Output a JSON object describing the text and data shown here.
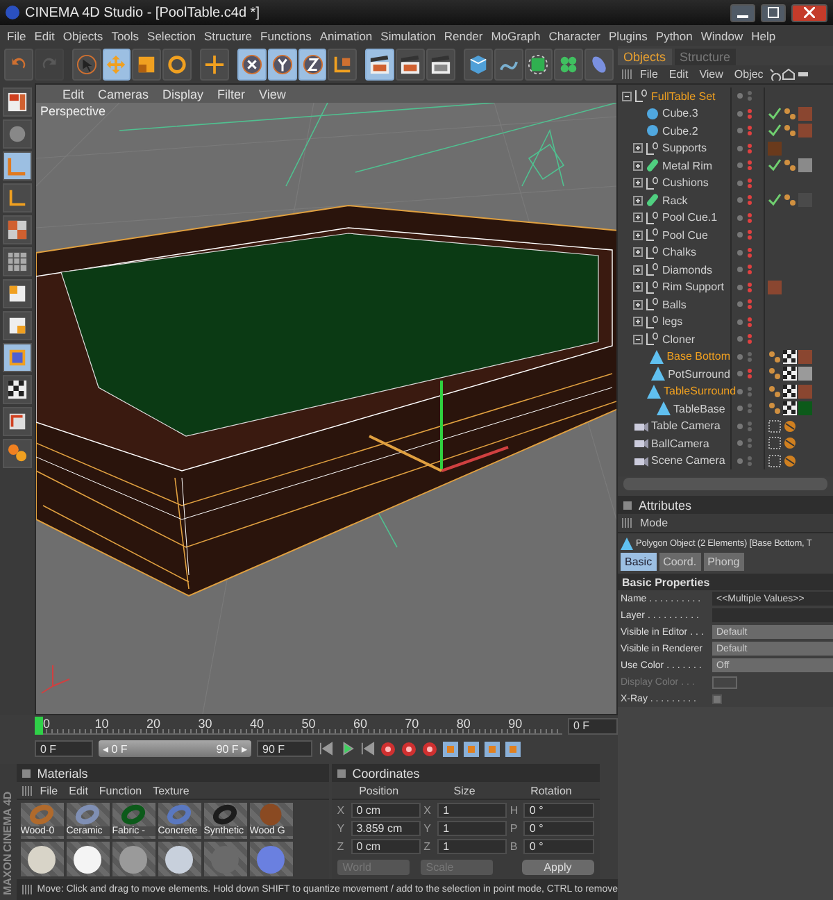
{
  "window": {
    "title": "CINEMA 4D Studio - [PoolTable.c4d *]"
  },
  "menu": [
    "File",
    "Edit",
    "Objects",
    "Tools",
    "Selection",
    "Structure",
    "Functions",
    "Animation",
    "Simulation",
    "Render",
    "MoGraph",
    "Character",
    "Plugins",
    "Python",
    "Window",
    "Help"
  ],
  "toolbar": [
    {
      "kind": "undo",
      "selected": false,
      "disabled": false
    },
    {
      "kind": "redo",
      "selected": false,
      "disabled": true
    },
    {
      "kind": "select",
      "selected": false,
      "disabled": false
    },
    {
      "kind": "move",
      "selected": true,
      "disabled": false
    },
    {
      "kind": "scale",
      "selected": false,
      "disabled": false
    },
    {
      "kind": "rotate",
      "selected": false,
      "disabled": false
    },
    {
      "kind": "add",
      "selected": false,
      "disabled": false
    },
    {
      "kind": "x",
      "selected": true,
      "disabled": false
    },
    {
      "kind": "y",
      "selected": true,
      "disabled": false
    },
    {
      "kind": "z",
      "selected": true,
      "disabled": false
    },
    {
      "kind": "coords",
      "selected": false,
      "disabled": false
    },
    {
      "kind": "render",
      "selected": true,
      "disabled": false
    },
    {
      "kind": "render",
      "selected": false,
      "disabled": false
    },
    {
      "kind": "render-settings",
      "selected": false,
      "disabled": false
    },
    {
      "kind": "cube",
      "selected": false,
      "disabled": false
    },
    {
      "kind": "spline",
      "selected": false,
      "disabled": false
    },
    {
      "kind": "nurbs",
      "selected": false,
      "disabled": false
    },
    {
      "kind": "array",
      "selected": false,
      "disabled": false
    },
    {
      "kind": "deformer",
      "selected": false,
      "disabled": false
    }
  ],
  "left_tools": [
    {
      "kind": "layout",
      "selected": false
    },
    {
      "kind": "sphere",
      "selected": false
    },
    {
      "kind": "model",
      "selected": true
    },
    {
      "kind": "axis",
      "selected": false
    },
    {
      "kind": "texture",
      "selected": false
    },
    {
      "kind": "grid",
      "selected": false
    },
    {
      "kind": "points",
      "selected": false
    },
    {
      "kind": "edges",
      "selected": false
    },
    {
      "kind": "polygons",
      "selected": true
    },
    {
      "kind": "checker",
      "selected": false
    },
    {
      "kind": "snap",
      "selected": false
    },
    {
      "kind": "paint",
      "selected": false
    }
  ],
  "viewport": {
    "menu": [
      "Edit",
      "Cameras",
      "Display",
      "Filter",
      "View"
    ],
    "label": "Perspective"
  },
  "timeline": {
    "ticks": [
      "0",
      "10",
      "20",
      "30",
      "40",
      "50",
      "60",
      "70",
      "80",
      "90"
    ],
    "level": 0,
    "current": "0 F",
    "start": "0 F",
    "range": {
      "start": "◂ 0 F",
      "end": "90 F ▸",
      "level": 1
    },
    "end": "90 F"
  },
  "logo": [
    "MAXON",
    "CINEMA 4D"
  ],
  "materials": {
    "title": "Materials",
    "menu": [
      "File",
      "Edit",
      "Function",
      "Texture"
    ],
    "items": [
      {
        "name": "Wood-0",
        "kind": "torus",
        "color": "#b06a2c"
      },
      {
        "name": "Ceramic",
        "kind": "torus",
        "color": "#7f8fb4"
      },
      {
        "name": "Fabric - ",
        "kind": "torus",
        "color": "#0c5a1a"
      },
      {
        "name": "Concrete",
        "kind": "torus",
        "color": "#5a78c0"
      },
      {
        "name": "Synthetic",
        "kind": "torus",
        "color": "#1c1c1c"
      },
      {
        "name": "Wood G",
        "kind": "sphere",
        "color": "#8a4a22"
      },
      {
        "kind": "sphere",
        "color": "#d8d4c8"
      },
      {
        "kind": "sphere",
        "color": "#f4f4f4"
      },
      {
        "kind": "sphere",
        "color": "#9a9a9a"
      },
      {
        "kind": "sphere",
        "color": "#c8d0dc"
      },
      {
        "kind": "sphere",
        "color": "#6a6a6a"
      },
      {
        "kind": "sphere",
        "color": "#6a80e0"
      }
    ]
  },
  "coordinates": {
    "title": "Coordinates",
    "headers": [
      "Position",
      "Size",
      "Rotation"
    ],
    "rows": [
      {
        "axis": "X",
        "position": "0 cm",
        "size_axis": "X",
        "size": "1",
        "rot_axis": "H",
        "rotation": "0 °"
      },
      {
        "axis": "Y",
        "position": "3.859 cm",
        "size_axis": "Y",
        "size": "1",
        "rot_axis": "P",
        "rotation": "0 °"
      },
      {
        "axis": "Z",
        "position": "0 cm",
        "size_axis": "Z",
        "size": "1",
        "rot_axis": "B",
        "rotation": "0 °"
      }
    ],
    "space": "World",
    "mode": "Scale",
    "apply": "Apply"
  },
  "status_bar": "Move: Click and drag to move elements. Hold down SHIFT to quantize movement / add to the selection in point mode, CTRL to remove",
  "objects": {
    "tabs": [
      {
        "label": "Objects",
        "selected": true
      },
      {
        "label": "Structure",
        "selected": false
      }
    ],
    "menu": [
      "File",
      "Edit",
      "View",
      "Objec"
    ],
    "tree": [
      {
        "name": "FullTable Set",
        "kind": "null",
        "selected": true,
        "expanded": true,
        "hidden": false,
        "children": [
          {
            "name": "Cube.3",
            "kind": "cube",
            "selected": false,
            "hidden": true,
            "tags": [
              {
                "kind": "check"
              },
              {
                "kind": "phong"
              },
              {
                "kind": "material",
                "color": "#8a4630"
              }
            ]
          },
          {
            "name": "Cube.2",
            "kind": "cube",
            "selected": false,
            "hidden": true,
            "tags": [
              {
                "kind": "check"
              },
              {
                "kind": "phong"
              },
              {
                "kind": "material",
                "color": "#8a4630"
              }
            ]
          },
          {
            "name": "Supports",
            "kind": "null",
            "selected": false,
            "expanded": false,
            "hidden": true,
            "tags": [
              {
                "kind": "material",
                "color": "#6a3a1c"
              }
            ]
          },
          {
            "name": "Metal Rim",
            "kind": "spline",
            "selected": false,
            "expanded": false,
            "hidden": true,
            "tags": [
              {
                "kind": "check"
              },
              {
                "kind": "phong"
              },
              {
                "kind": "material",
                "color": "#8a8a8a"
              }
            ]
          },
          {
            "name": "Cushions",
            "kind": "null",
            "selected": false,
            "expanded": false,
            "hidden": true
          },
          {
            "name": "Rack",
            "kind": "spline",
            "selected": false,
            "expanded": false,
            "hidden": true,
            "tags": [
              {
                "kind": "check"
              },
              {
                "kind": "phong"
              },
              {
                "kind": "material",
                "color": "#4a4a4a"
              }
            ]
          },
          {
            "name": "Pool Cue.1",
            "kind": "null",
            "selected": false,
            "expanded": false,
            "hidden": true
          },
          {
            "name": "Pool Cue",
            "kind": "null",
            "selected": false,
            "expanded": false,
            "hidden": true
          },
          {
            "name": "Chalks",
            "kind": "null",
            "selected": false,
            "expanded": false,
            "hidden": true
          },
          {
            "name": "Diamonds",
            "kind": "null",
            "selected": false,
            "expanded": false,
            "hidden": true
          },
          {
            "name": "Rim Support",
            "kind": "null",
            "selected": false,
            "expanded": false,
            "hidden": true,
            "tags": [
              {
                "kind": "material",
                "color": "#8a4630"
              }
            ]
          },
          {
            "name": "Balls",
            "kind": "null",
            "selected": false,
            "expanded": false,
            "hidden": true
          },
          {
            "name": "legs",
            "kind": "null",
            "selected": false,
            "expanded": false,
            "hidden": true
          },
          {
            "name": "Cloner",
            "kind": "null",
            "selected": false,
            "expanded": true,
            "hidden": true,
            "children": [
              {
                "name": "Base Bottom",
                "kind": "polygon",
                "selected": true,
                "hidden": false,
                "tags": [
                  {
                    "kind": "phong"
                  },
                  {
                    "kind": "texture"
                  },
                  {
                    "kind": "material",
                    "color": "#8a4630"
                  }
                ]
              },
              {
                "name": "PotSurround",
                "kind": "polygon",
                "selected": false,
                "hidden": true,
                "tags": [
                  {
                    "kind": "phong"
                  },
                  {
                    "kind": "texture"
                  },
                  {
                    "kind": "material",
                    "color": "#9a9a9a"
                  }
                ]
              },
              {
                "name": "TableSurround",
                "kind": "polygon",
                "selected": true,
                "hidden": false,
                "tags": [
                  {
                    "kind": "phong"
                  },
                  {
                    "kind": "texture"
                  },
                  {
                    "kind": "material",
                    "color": "#8a4630"
                  }
                ]
              },
              {
                "name": "TableBase",
                "kind": "polygon",
                "selected": false,
                "hidden": false,
                "tags": [
                  {
                    "kind": "phong"
                  },
                  {
                    "kind": "texture"
                  },
                  {
                    "kind": "material",
                    "color": "#0c5a1a"
                  }
                ]
              }
            ]
          }
        ]
      },
      {
        "name": "Table Camera",
        "kind": "camera",
        "selected": false,
        "hidden": false,
        "tags": [
          {
            "kind": "target"
          },
          {
            "kind": "protection"
          }
        ]
      },
      {
        "name": "BallCamera",
        "kind": "camera",
        "selected": false,
        "hidden": false,
        "tags": [
          {
            "kind": "target"
          },
          {
            "kind": "protection"
          }
        ]
      },
      {
        "name": "Scene Camera",
        "kind": "camera",
        "selected": false,
        "hidden": false,
        "tags": [
          {
            "kind": "target"
          },
          {
            "kind": "protection"
          }
        ]
      }
    ]
  },
  "attributes": {
    "title": "Attributes",
    "menu": "Mode",
    "object": "Polygon Object (2 Elements) [Base Bottom, T",
    "tabs": [
      {
        "label": "Basic",
        "selected": true
      },
      {
        "label": "Coord.",
        "selected": false
      },
      {
        "label": "Phong",
        "selected": false
      }
    ],
    "section": "Basic Properties",
    "properties": [
      {
        "label": "Name . . . . . . . . . .",
        "kind": "field",
        "value": "<<Multiple Values>>",
        "disabled": false
      },
      {
        "label": "Layer . . . . . . . . . .",
        "kind": "layer",
        "disabled": false
      },
      {
        "label": "Visible in Editor . . .",
        "kind": "dropdown",
        "value": "Default",
        "disabled": false
      },
      {
        "label": "Visible in Renderer",
        "kind": "dropdown",
        "value": "Default",
        "disabled": false
      },
      {
        "label": "Use Color . . . . . . .",
        "kind": "dropdown",
        "value": "Off",
        "disabled": false
      },
      {
        "label": "Display Color . . .",
        "kind": "color",
        "disabled": true
      },
      {
        "label": "X-Ray . . . . . . . . .",
        "kind": "checkbox",
        "checked": false,
        "disabled": false
      }
    ]
  }
}
